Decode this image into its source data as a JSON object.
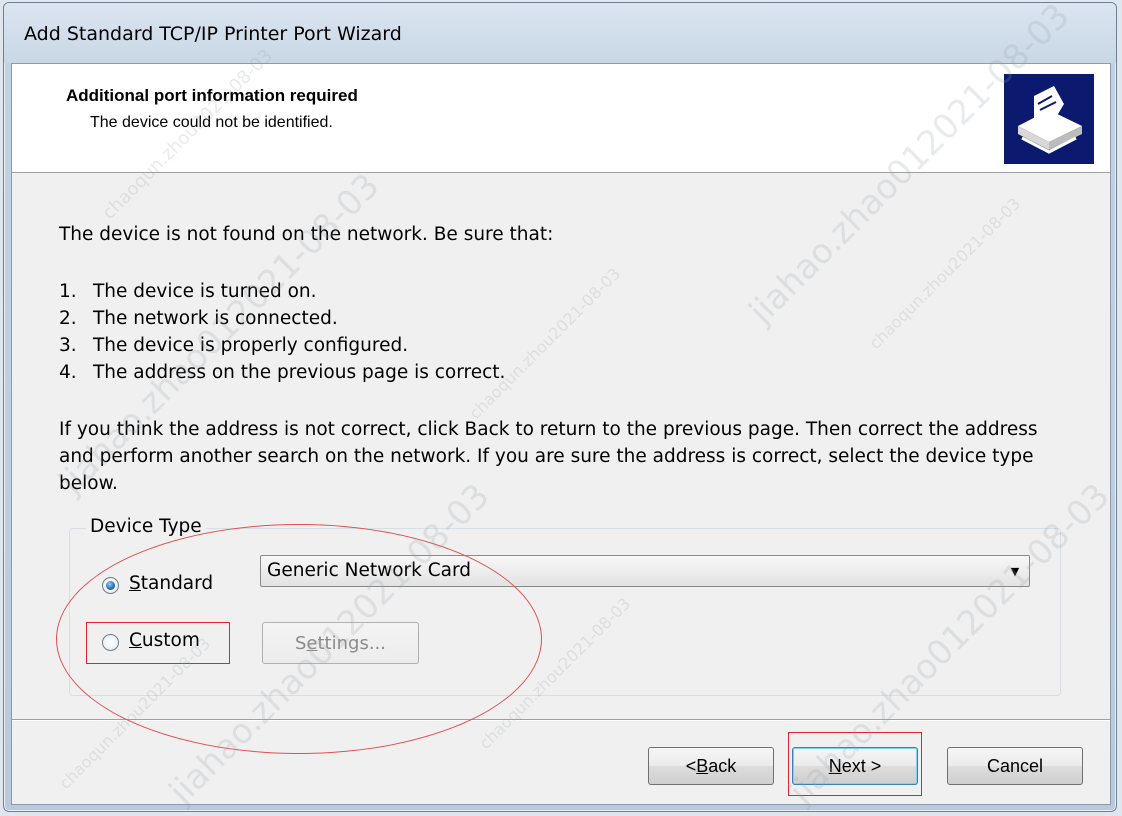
{
  "window": {
    "title": "Add Standard TCP/IP Printer Port Wizard"
  },
  "header": {
    "title": "Additional port information required",
    "subtitle": "The device could not be identified.",
    "icon": "printer-wizard-icon"
  },
  "main": {
    "message": "The device is not found on the network.  Be sure that:",
    "list": [
      {
        "num": "1.",
        "text": "The device is turned on."
      },
      {
        "num": "2.",
        "text": "The network is connected."
      },
      {
        "num": "3.",
        "text": "The device is properly configured."
      },
      {
        "num": "4.",
        "text": "The address on the previous page is correct."
      }
    ],
    "paragraph": "If you think the address is not correct, click Back to return to the previous page.  Then correct the address and perform another search on the network.  If you are sure the address is correct, select the device type below."
  },
  "device_type": {
    "label": "Device Type",
    "standard": {
      "label_mnemonic": "S",
      "label_rest": "tandard",
      "selected": true
    },
    "standard_value": "Generic Network Card",
    "custom": {
      "label_mnemonic": "C",
      "label_rest": "ustom",
      "selected": false
    },
    "settings": {
      "label_pre": "S",
      "label_mnemonic": "e",
      "label_post": "ttings..."
    }
  },
  "buttons": {
    "back": {
      "pre": "< ",
      "mnemonic": "B",
      "rest": "ack"
    },
    "next": {
      "mnemonic": "N",
      "rest": "ext >"
    },
    "cancel": "Cancel"
  },
  "colors": {
    "header_icon_bg": "#0b1a6e",
    "annotation_red": "#e0242a",
    "client_bg": "#f0f0f0"
  },
  "watermarks": [
    "chaoqun.zhou2021-08-03",
    "jiahao.zhao012021-08-03",
    "chaoqun.zhou2021-08-03",
    "jiahao.zhao012021-08-03",
    "chaoqun.zhou2021-08-03",
    "jiahao.zhao012021-08-03",
    "chaoqun.zhou2021-08-03",
    "jiahao.zhao012021-08-03",
    "chaoqun.zhou2021-08-03"
  ]
}
